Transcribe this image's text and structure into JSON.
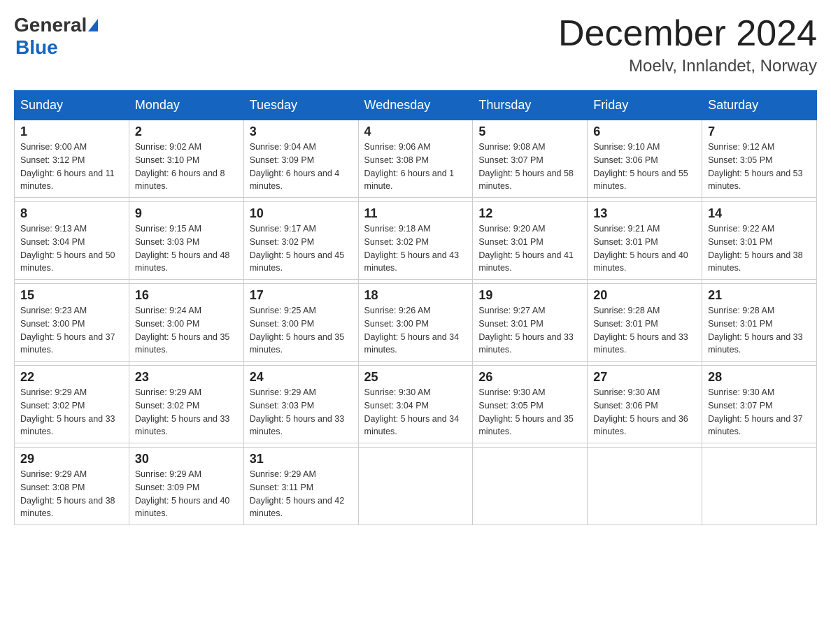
{
  "header": {
    "logo_general": "General",
    "logo_blue": "Blue",
    "month_title": "December 2024",
    "location": "Moelv, Innlandet, Norway"
  },
  "weekdays": [
    "Sunday",
    "Monday",
    "Tuesday",
    "Wednesday",
    "Thursday",
    "Friday",
    "Saturday"
  ],
  "weeks": [
    [
      {
        "day": "1",
        "sunrise": "9:00 AM",
        "sunset": "3:12 PM",
        "daylight": "6 hours and 11 minutes."
      },
      {
        "day": "2",
        "sunrise": "9:02 AM",
        "sunset": "3:10 PM",
        "daylight": "6 hours and 8 minutes."
      },
      {
        "day": "3",
        "sunrise": "9:04 AM",
        "sunset": "3:09 PM",
        "daylight": "6 hours and 4 minutes."
      },
      {
        "day": "4",
        "sunrise": "9:06 AM",
        "sunset": "3:08 PM",
        "daylight": "6 hours and 1 minute."
      },
      {
        "day": "5",
        "sunrise": "9:08 AM",
        "sunset": "3:07 PM",
        "daylight": "5 hours and 58 minutes."
      },
      {
        "day": "6",
        "sunrise": "9:10 AM",
        "sunset": "3:06 PM",
        "daylight": "5 hours and 55 minutes."
      },
      {
        "day": "7",
        "sunrise": "9:12 AM",
        "sunset": "3:05 PM",
        "daylight": "5 hours and 53 minutes."
      }
    ],
    [
      {
        "day": "8",
        "sunrise": "9:13 AM",
        "sunset": "3:04 PM",
        "daylight": "5 hours and 50 minutes."
      },
      {
        "day": "9",
        "sunrise": "9:15 AM",
        "sunset": "3:03 PM",
        "daylight": "5 hours and 48 minutes."
      },
      {
        "day": "10",
        "sunrise": "9:17 AM",
        "sunset": "3:02 PM",
        "daylight": "5 hours and 45 minutes."
      },
      {
        "day": "11",
        "sunrise": "9:18 AM",
        "sunset": "3:02 PM",
        "daylight": "5 hours and 43 minutes."
      },
      {
        "day": "12",
        "sunrise": "9:20 AM",
        "sunset": "3:01 PM",
        "daylight": "5 hours and 41 minutes."
      },
      {
        "day": "13",
        "sunrise": "9:21 AM",
        "sunset": "3:01 PM",
        "daylight": "5 hours and 40 minutes."
      },
      {
        "day": "14",
        "sunrise": "9:22 AM",
        "sunset": "3:01 PM",
        "daylight": "5 hours and 38 minutes."
      }
    ],
    [
      {
        "day": "15",
        "sunrise": "9:23 AM",
        "sunset": "3:00 PM",
        "daylight": "5 hours and 37 minutes."
      },
      {
        "day": "16",
        "sunrise": "9:24 AM",
        "sunset": "3:00 PM",
        "daylight": "5 hours and 35 minutes."
      },
      {
        "day": "17",
        "sunrise": "9:25 AM",
        "sunset": "3:00 PM",
        "daylight": "5 hours and 35 minutes."
      },
      {
        "day": "18",
        "sunrise": "9:26 AM",
        "sunset": "3:00 PM",
        "daylight": "5 hours and 34 minutes."
      },
      {
        "day": "19",
        "sunrise": "9:27 AM",
        "sunset": "3:01 PM",
        "daylight": "5 hours and 33 minutes."
      },
      {
        "day": "20",
        "sunrise": "9:28 AM",
        "sunset": "3:01 PM",
        "daylight": "5 hours and 33 minutes."
      },
      {
        "day": "21",
        "sunrise": "9:28 AM",
        "sunset": "3:01 PM",
        "daylight": "5 hours and 33 minutes."
      }
    ],
    [
      {
        "day": "22",
        "sunrise": "9:29 AM",
        "sunset": "3:02 PM",
        "daylight": "5 hours and 33 minutes."
      },
      {
        "day": "23",
        "sunrise": "9:29 AM",
        "sunset": "3:02 PM",
        "daylight": "5 hours and 33 minutes."
      },
      {
        "day": "24",
        "sunrise": "9:29 AM",
        "sunset": "3:03 PM",
        "daylight": "5 hours and 33 minutes."
      },
      {
        "day": "25",
        "sunrise": "9:30 AM",
        "sunset": "3:04 PM",
        "daylight": "5 hours and 34 minutes."
      },
      {
        "day": "26",
        "sunrise": "9:30 AM",
        "sunset": "3:05 PM",
        "daylight": "5 hours and 35 minutes."
      },
      {
        "day": "27",
        "sunrise": "9:30 AM",
        "sunset": "3:06 PM",
        "daylight": "5 hours and 36 minutes."
      },
      {
        "day": "28",
        "sunrise": "9:30 AM",
        "sunset": "3:07 PM",
        "daylight": "5 hours and 37 minutes."
      }
    ],
    [
      {
        "day": "29",
        "sunrise": "9:29 AM",
        "sunset": "3:08 PM",
        "daylight": "5 hours and 38 minutes."
      },
      {
        "day": "30",
        "sunrise": "9:29 AM",
        "sunset": "3:09 PM",
        "daylight": "5 hours and 40 minutes."
      },
      {
        "day": "31",
        "sunrise": "9:29 AM",
        "sunset": "3:11 PM",
        "daylight": "5 hours and 42 minutes."
      },
      null,
      null,
      null,
      null
    ]
  ]
}
